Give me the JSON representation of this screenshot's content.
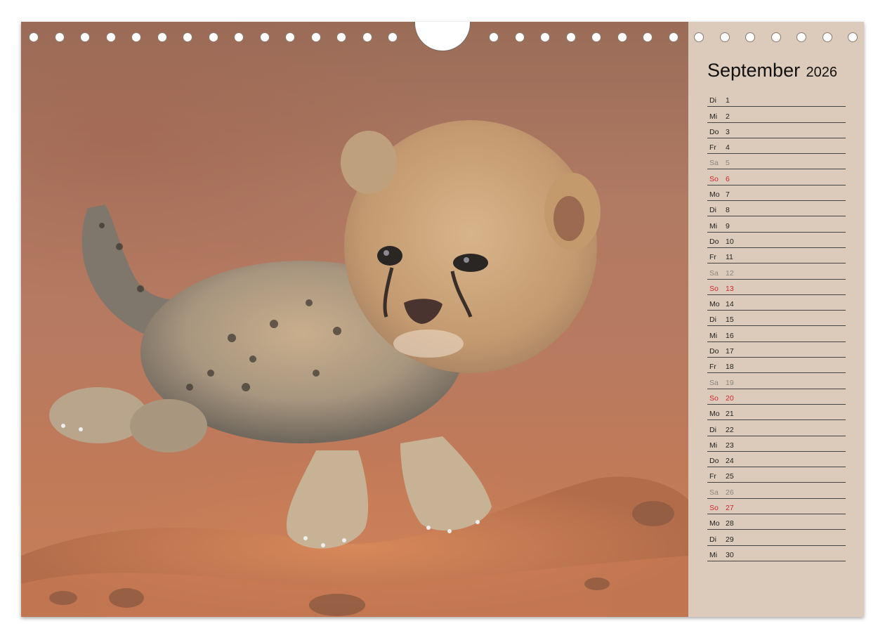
{
  "calendar": {
    "month": "September",
    "year": "2026",
    "days": [
      {
        "wd": "Di",
        "n": "1",
        "type": "weekday"
      },
      {
        "wd": "Mi",
        "n": "2",
        "type": "weekday"
      },
      {
        "wd": "Do",
        "n": "3",
        "type": "weekday"
      },
      {
        "wd": "Fr",
        "n": "4",
        "type": "weekday"
      },
      {
        "wd": "Sa",
        "n": "5",
        "type": "sat"
      },
      {
        "wd": "So",
        "n": "6",
        "type": "sun"
      },
      {
        "wd": "Mo",
        "n": "7",
        "type": "weekday"
      },
      {
        "wd": "Di",
        "n": "8",
        "type": "weekday"
      },
      {
        "wd": "Mi",
        "n": "9",
        "type": "weekday"
      },
      {
        "wd": "Do",
        "n": "10",
        "type": "weekday"
      },
      {
        "wd": "Fr",
        "n": "11",
        "type": "weekday"
      },
      {
        "wd": "Sa",
        "n": "12",
        "type": "sat"
      },
      {
        "wd": "So",
        "n": "13",
        "type": "sun"
      },
      {
        "wd": "Mo",
        "n": "14",
        "type": "weekday"
      },
      {
        "wd": "Di",
        "n": "15",
        "type": "weekday"
      },
      {
        "wd": "Mi",
        "n": "16",
        "type": "weekday"
      },
      {
        "wd": "Do",
        "n": "17",
        "type": "weekday"
      },
      {
        "wd": "Fr",
        "n": "18",
        "type": "weekday"
      },
      {
        "wd": "Sa",
        "n": "19",
        "type": "sat"
      },
      {
        "wd": "So",
        "n": "20",
        "type": "sun"
      },
      {
        "wd": "Mo",
        "n": "21",
        "type": "weekday"
      },
      {
        "wd": "Di",
        "n": "22",
        "type": "weekday"
      },
      {
        "wd": "Mi",
        "n": "23",
        "type": "weekday"
      },
      {
        "wd": "Do",
        "n": "24",
        "type": "weekday"
      },
      {
        "wd": "Fr",
        "n": "25",
        "type": "weekday"
      },
      {
        "wd": "Sa",
        "n": "26",
        "type": "sat"
      },
      {
        "wd": "So",
        "n": "27",
        "type": "sun"
      },
      {
        "wd": "Mo",
        "n": "28",
        "type": "weekday"
      },
      {
        "wd": "Di",
        "n": "29",
        "type": "weekday"
      },
      {
        "wd": "Mi",
        "n": "30",
        "type": "weekday"
      }
    ]
  },
  "photo": {
    "subject": "cheetah-cub-icon"
  },
  "colors": {
    "sidebar_bg": "#dccbbb",
    "sunday": "#d2282a",
    "saturday": "#8b8580"
  }
}
